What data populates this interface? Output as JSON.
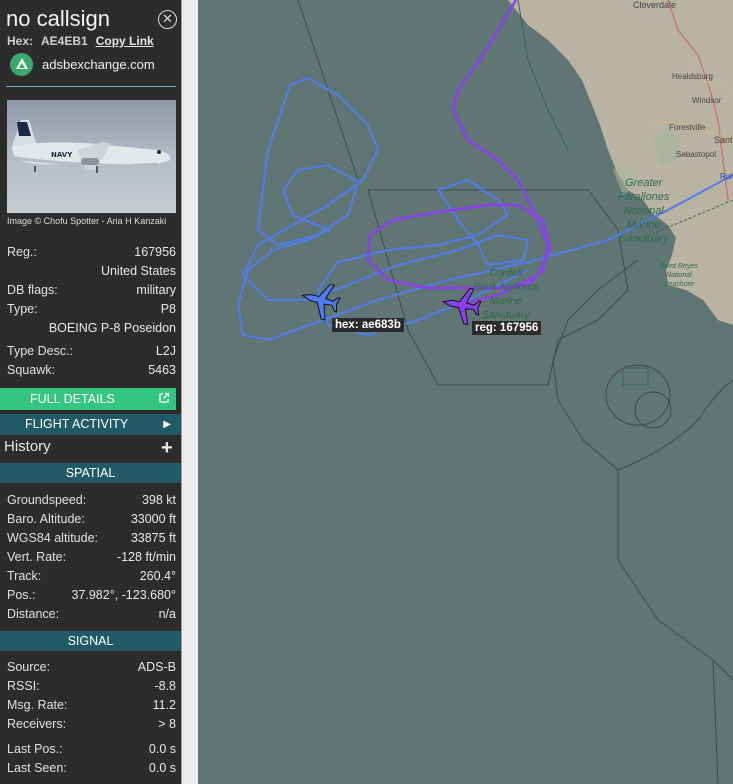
{
  "title": "no callsign",
  "hex_label": "Hex:",
  "hex_value": "AE4EB1",
  "copy_link": "Copy Link",
  "site": "adsbexchange.com",
  "photo_credit": "Image © Chofu Spotter - Aria H Kanzaki",
  "photo_tail_text": "NAVY",
  "info": {
    "reg_label": "Reg.:",
    "reg_value": "167956",
    "country": "United States",
    "dbflags_label": "DB flags:",
    "dbflags_value": "military",
    "type_label": "Type:",
    "type_value": "P8",
    "type_name": "BOEING P-8 Poseidon",
    "typedesc_label": "Type Desc.:",
    "typedesc_value": "L2J",
    "squawk_label": "Squawk:",
    "squawk_value": "5463"
  },
  "buttons": {
    "full_details": "FULL DETAILS",
    "flight_activity": "FLIGHT ACTIVITY",
    "history": "History",
    "history_add": "+"
  },
  "spatial": {
    "header": "SPATIAL",
    "groundspeed_label": "Groundspeed:",
    "groundspeed_value": "398 kt",
    "baro_label": "Baro. Altitude:",
    "baro_value": "33000 ft",
    "wgs_label": "WGS84 altitude:",
    "wgs_value": "33875 ft",
    "vert_label": "Vert. Rate:",
    "vert_value": "-128 ft/min",
    "track_label": "Track:",
    "track_value": "260.4°",
    "pos_label": "Pos.:",
    "pos_value": "37.982°, -123.680°",
    "dist_label": "Distance:",
    "dist_value": "n/a"
  },
  "signal": {
    "header": "SIGNAL",
    "source_label": "Source:",
    "source_value": "ADS-B",
    "rssi_label": "RSSI:",
    "rssi_value": "-8.8",
    "msg_label": "Msg. Rate:",
    "msg_value": "11.2",
    "rec_label": "Receivers:",
    "rec_value": "> 8",
    "lastpos_label": "Last Pos.:",
    "lastpos_value": "0.0 s",
    "lastseen_label": "Last Seen:",
    "lastseen_value": "0.0 s"
  },
  "map": {
    "aircraft1_label": "hex: ae683b",
    "aircraft2_label": "reg: 167956",
    "places": {
      "cloverdale": "Cloverdale",
      "healdsburg": "Healdsburg",
      "windsor": "Windsor",
      "forestville": "Forestville",
      "santa": "Sant",
      "sebastopol": "Sebastopol",
      "rohn": "Rohn",
      "gf1": "Greater",
      "gf2": "Farallones",
      "gf3": "National",
      "gf4": "Marine",
      "gf5": "Sanctuary",
      "cb1": "Cordell",
      "cb2": "Bank National",
      "cb3": "Marine",
      "cb4": "Sanctuary",
      "pr1": "Point Reyes",
      "pr2": "National",
      "pr3": "Seashore"
    }
  },
  "colors": {
    "sidebar_bg": "#2c2c2c",
    "accent_green": "#34c680",
    "header_teal": "#1f5a66",
    "track_blue": "#4f7df0",
    "track_purple": "#8a3ff0",
    "ocean": "#5f7675",
    "land": "#b9b3a2"
  }
}
